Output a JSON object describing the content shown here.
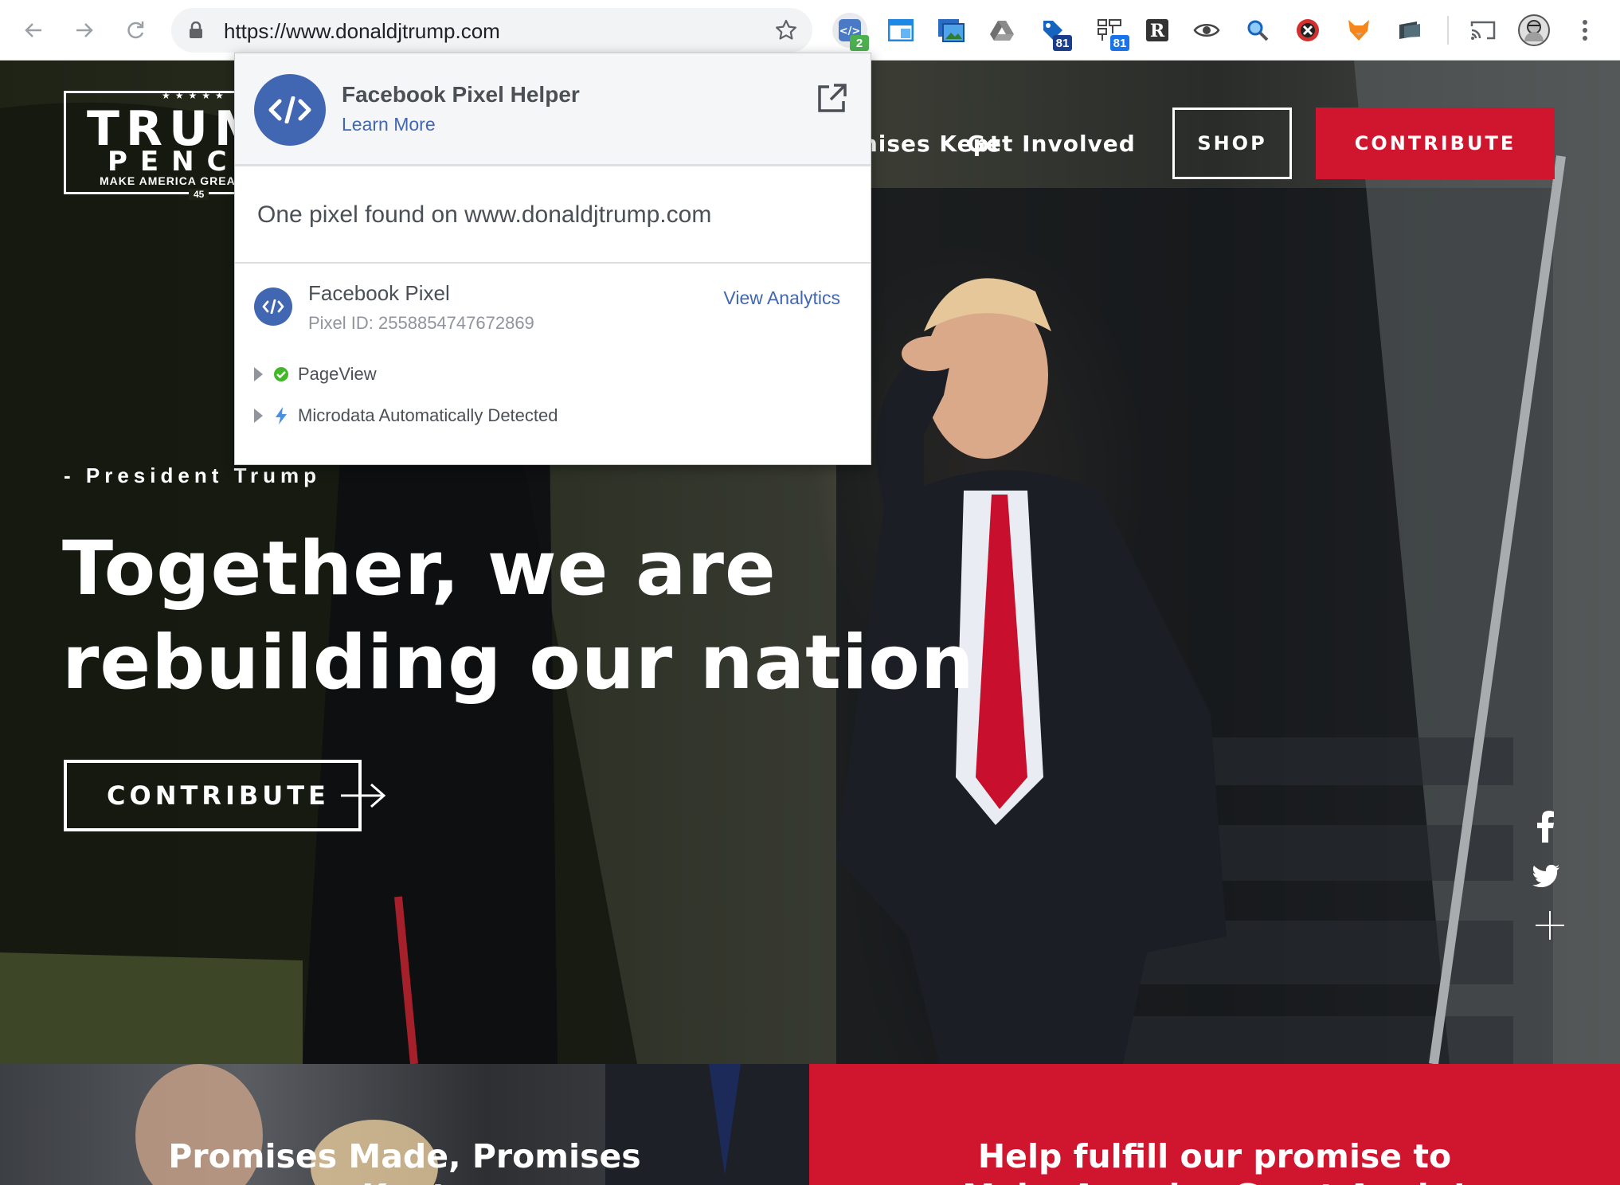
{
  "browser": {
    "url": "https://www.donaldjtrump.com",
    "extensions": [
      {
        "name": "pixel-helper-icon",
        "badge": "2",
        "badge_color": "#4caf50"
      },
      {
        "name": "window-icon",
        "badge": ""
      },
      {
        "name": "screenshot-icon",
        "badge": ""
      },
      {
        "name": "drive-icon",
        "badge": ""
      },
      {
        "name": "tag-icon",
        "badge": "81",
        "badge_color": "#1a3e8c"
      },
      {
        "name": "tag-assistant-icon",
        "badge": "81",
        "badge_color": "#1a73e8"
      },
      {
        "name": "r-icon",
        "badge": ""
      },
      {
        "name": "eye-icon",
        "badge": ""
      },
      {
        "name": "magnifier-icon",
        "badge": ""
      },
      {
        "name": "blocker-icon",
        "badge": ""
      },
      {
        "name": "fox-icon",
        "badge": ""
      },
      {
        "name": "folder-icon",
        "badge": ""
      }
    ]
  },
  "site": {
    "logo": {
      "trump": "TRUMP",
      "pence": "PENCE",
      "tagline": "MAKE AMERICA GREAT AGAIN!",
      "number": "45",
      "stars": "★★★★★"
    },
    "nav": [
      {
        "label": "Promises Kept"
      },
      {
        "label": "Get Involved"
      }
    ],
    "shop_label": "SHOP",
    "contribute_label": "CONTRIBUTE",
    "accent_color": "#d0152f",
    "hero": {
      "quote_by": "- President Trump",
      "headline_line1": "Together, we are",
      "headline_line2": "rebuilding our nation",
      "cta_label": "CONTRIBUTE"
    },
    "social": [
      "facebook-icon",
      "twitter-icon",
      "plus-icon"
    ],
    "bottom_left": {
      "title": "Promises Made, Promises",
      "subtitle": "Kept"
    },
    "bottom_right": {
      "title": "Help fulfill our promise to",
      "subtitle": "Make America Great Again!"
    }
  },
  "popup": {
    "title": "Facebook Pixel Helper",
    "learn_more": "Learn More",
    "summary": "One pixel found on www.donaldjtrump.com",
    "pixel_name": "Facebook Pixel",
    "pixel_id": "Pixel ID: 2558854747672869",
    "view_analytics": "View Analytics",
    "events": [
      {
        "label": "PageView",
        "status": "success"
      },
      {
        "label": "Microdata Automatically Detected",
        "status": "info"
      }
    ],
    "brand_color": "#4267b2"
  }
}
